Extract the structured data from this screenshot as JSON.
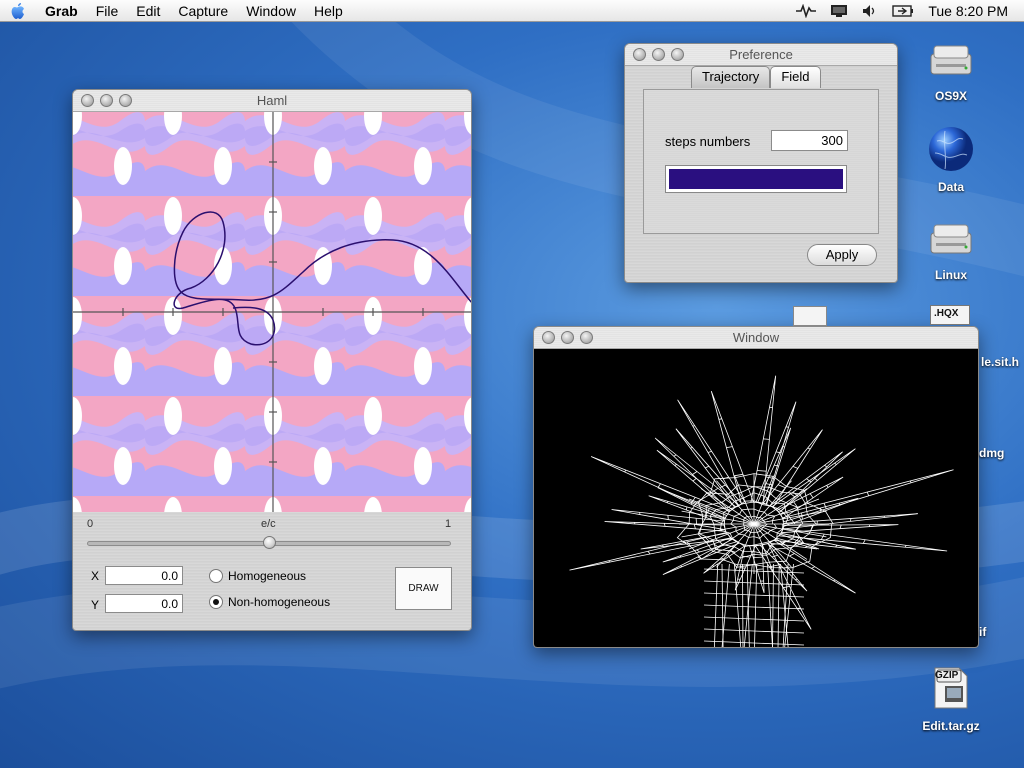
{
  "menubar": {
    "app_name": "Grab",
    "items": [
      "File",
      "Edit",
      "Capture",
      "Window",
      "Help"
    ],
    "clock": "Tue 8:20 PM",
    "status_icons": [
      "spark-icon",
      "display-icon",
      "speaker-icon",
      "battery-icon"
    ]
  },
  "haml_window": {
    "title": "Haml",
    "slider": {
      "label": "e/c",
      "min_label": "0",
      "max_label": "1",
      "value": 0.5
    },
    "x_label": "X",
    "x_value": "0.0",
    "y_label": "Y",
    "y_value": "0.0",
    "options": [
      "Homogeneous",
      "Non-homogeneous"
    ],
    "selected_option": "Non-homogeneous",
    "draw_label": "DRAW"
  },
  "preference_window": {
    "title": "Preference",
    "tabs": [
      "Trajectory",
      "Field"
    ],
    "active_tab": "Trajectory",
    "steps_label": "steps numbers",
    "steps_value": "300",
    "trajectory_color": "#2a0f80",
    "apply_label": "Apply"
  },
  "window_3d": {
    "title": "Window"
  },
  "desktop": {
    "icons": [
      {
        "name": "OS9X",
        "icon": "hard-drive-icon"
      },
      {
        "name": "Data",
        "icon": "globe-icon"
      },
      {
        "name": "Linux",
        "icon": "hard-drive-icon"
      },
      {
        "name": "Edit.tar.gz",
        "icon": "gzip-archive-icon"
      }
    ],
    "partial_labels": [
      "le.sit.h",
      "dmg",
      "if"
    ],
    "hqx_badge": ".HQX",
    "gzip_badge": "GZIP"
  },
  "colors": {
    "plot_pink": "#f3a6c4",
    "plot_lavender": "#b6a9f7",
    "curve": "#2a0f6e",
    "wireframe": "#ffffff"
  }
}
